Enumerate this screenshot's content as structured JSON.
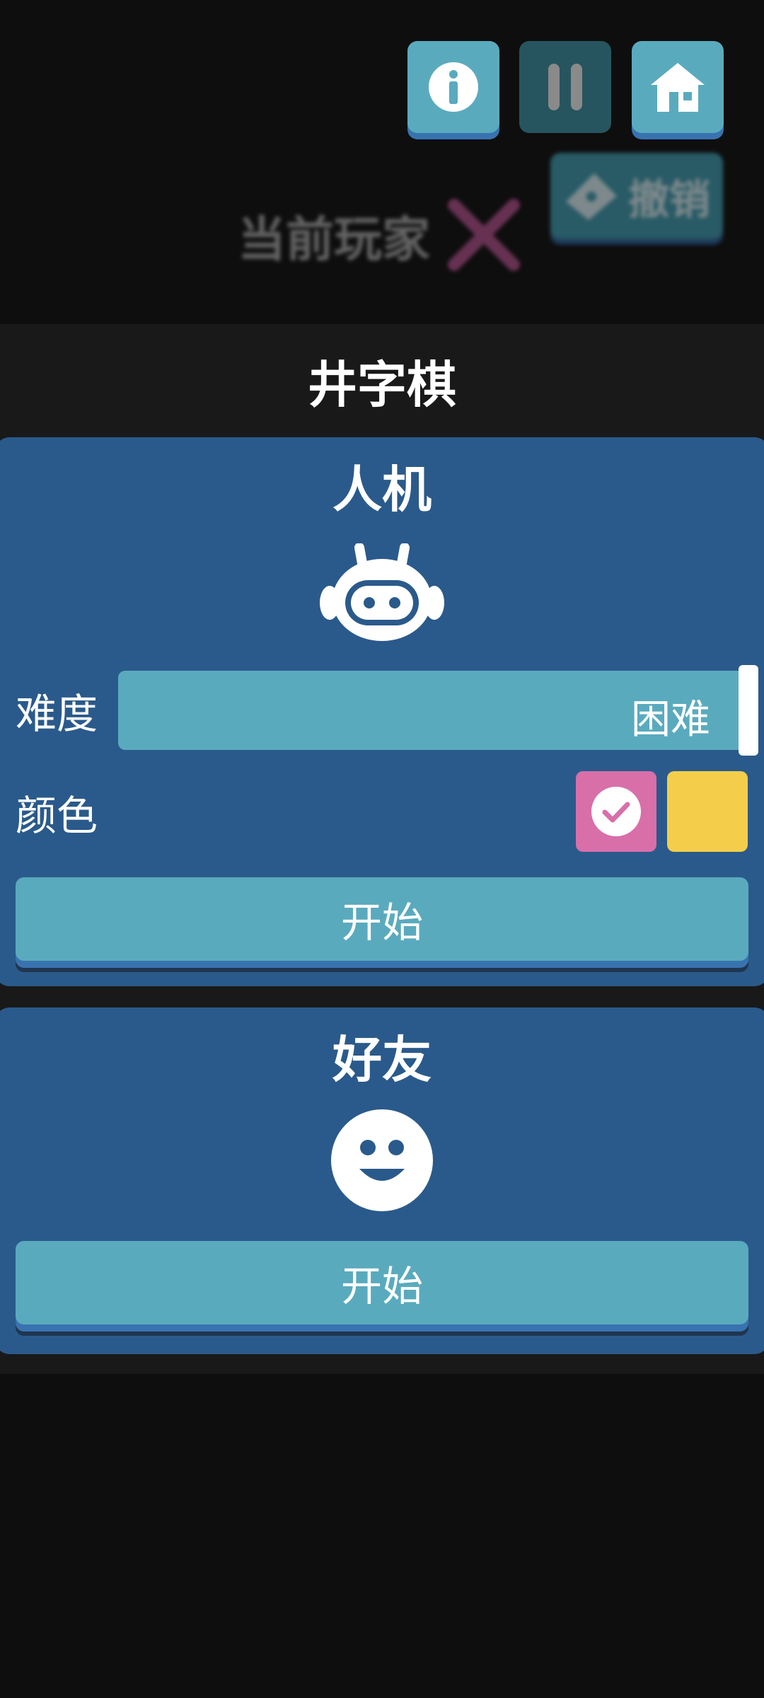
{
  "toolbar": {
    "info_icon": "info-icon",
    "pause_icon": "pause-icon",
    "home_icon": "home-icon"
  },
  "background": {
    "undo_label": "撤销",
    "current_player_label": "当前玩家"
  },
  "dialog": {
    "title": "井字棋",
    "ai_mode": {
      "title": "人机",
      "icon": "robot-icon",
      "difficulty_label": "难度",
      "difficulty_value": "困难",
      "color_label": "颜色",
      "colors": [
        "#d86fa9",
        "#f4ce4a"
      ],
      "start_label": "开始"
    },
    "friend_mode": {
      "title": "好友",
      "icon": "smiley-icon",
      "start_label": "开始"
    }
  }
}
